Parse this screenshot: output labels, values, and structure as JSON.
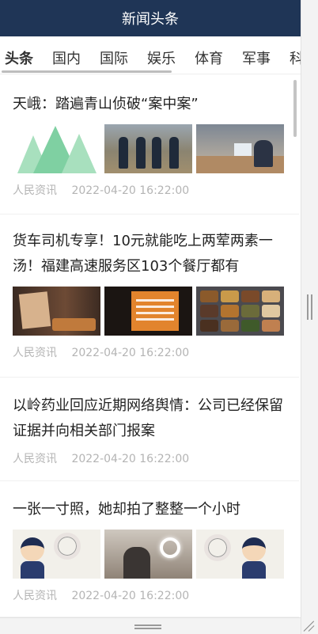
{
  "header": {
    "title": "新闻头条"
  },
  "tabs": [
    {
      "label": "头条",
      "active": true
    },
    {
      "label": "国内",
      "active": false
    },
    {
      "label": "国际",
      "active": false
    },
    {
      "label": "娱乐",
      "active": false
    },
    {
      "label": "体育",
      "active": false
    },
    {
      "label": "军事",
      "active": false
    },
    {
      "label": "科技",
      "active": false
    }
  ],
  "articles": [
    {
      "title": "天峨：踏遍青山侦破“案中案”",
      "source": "人民资讯",
      "time": "2022-04-20 16:22:00",
      "images": [
        "tree-logo-image",
        "police-group-image",
        "office-interview-image"
      ]
    },
    {
      "title": "货车司机专享！10元就能吃上两荤两素一汤！福建高速服务区103个餐厅都有",
      "source": "人民资讯",
      "time": "2022-04-20 16:22:00",
      "images": [
        "menu-sign-image",
        "price-board-image",
        "food-trays-image"
      ]
    },
    {
      "title": "以岭药业回应近期网络舆情：公司已经保留证据并向相关部门报案",
      "source": "人民资讯",
      "time": "2022-04-20 16:22:00",
      "images": []
    },
    {
      "title": "一张一寸照，她却拍了整整一个小时",
      "source": "人民资讯",
      "time": "2022-04-20 16:22:00",
      "images": [
        "cartoon-photo-image",
        "photo-session-image",
        "cartoon-ring-light-image"
      ]
    }
  ],
  "colors": {
    "header_bg": "#1f3556",
    "meta_text": "#b4b4b4",
    "tab_underline": "#bdbdbd"
  }
}
